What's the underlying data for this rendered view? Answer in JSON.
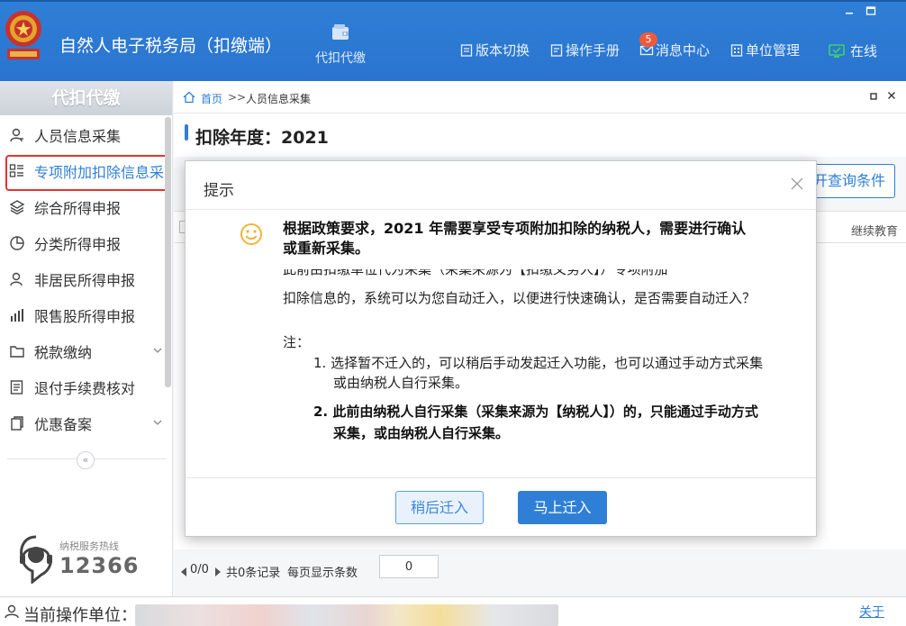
{
  "header": {
    "app_title": "自然人电子税务局（扣缴端）",
    "main_nav": {
      "label": "代扣代缴",
      "icon": "wallet-icon"
    },
    "window_controls": [
      "minimize",
      "restore"
    ],
    "tools": [
      {
        "label": "版本切换",
        "icon": "document-icon"
      },
      {
        "label": "操作手册",
        "icon": "manual-icon"
      },
      {
        "label": "消息中心",
        "icon": "mail-icon",
        "badge": "5"
      },
      {
        "label": "单位管理",
        "icon": "building-icon"
      }
    ],
    "status": {
      "label": "在线",
      "icon": "monitor-check-icon",
      "color": "#3bd36a"
    }
  },
  "sidebar": {
    "title": "代扣代缴",
    "items": [
      {
        "label": "人员信息采集",
        "icon": "person-icon"
      },
      {
        "label": "专项附加扣除信息采集",
        "icon": "list-icon",
        "active": true
      },
      {
        "label": "综合所得申报",
        "icon": "layers-icon"
      },
      {
        "label": "分类所得申报",
        "icon": "pie-icon"
      },
      {
        "label": "非居民所得申报",
        "icon": "person-outline-icon"
      },
      {
        "label": "限售股所得申报",
        "icon": "bar-chart-icon"
      },
      {
        "label": "税款缴纳",
        "icon": "folder-icon",
        "expandable": true
      },
      {
        "label": "退付手续费核对",
        "icon": "checklist-icon"
      },
      {
        "label": "优惠备案",
        "icon": "copy-icon",
        "expandable": true
      }
    ],
    "collapse_glyph": "«",
    "hotline": {
      "label": "纳税服务热线",
      "number": "12366"
    }
  },
  "breadcrumb": {
    "home": "首页",
    "separator": ">>",
    "current": "人员信息采集"
  },
  "page": {
    "year_title": "扣除年度：2021",
    "query_button": "开查询条件",
    "table": {
      "visible_column": "继续教育"
    },
    "pager": {
      "position": "0/0",
      "total": "共0条记录",
      "page_size_label": "每页显示条数",
      "page_size": "0"
    }
  },
  "modal": {
    "title": "提示",
    "headline": "根据政策要求，2021 年需要享受专项附加扣除的纳税人，需要进行确认或重新采集。",
    "clipped_line": "此前由扣缴单位代为采集（采集来源为【扣缴义务人】）专项附加",
    "body": "扣除信息的，系统可以为您自动迁入，以便进行快速确认，是否需要自动迁入？",
    "note_label": "注：",
    "note_1": "1. 选择暂不迁入的，可以稍后手动发起迁入功能，也可以通过手动方式采集或由纳税人自行采集。",
    "note_2": "2. 此前由纳税人自行采集（采集来源为【纳税人】）的，只能通过手动方式采集，或由纳税人自行采集。",
    "btn_later": "稍后迁入",
    "btn_now": "马上迁入"
  },
  "footer": {
    "unit_label": "当前操作单位：",
    "about": "关于"
  },
  "colors": {
    "brand": "#2f7fd6",
    "active_outline": "#e8312f",
    "smiley": "#f0b43a"
  }
}
